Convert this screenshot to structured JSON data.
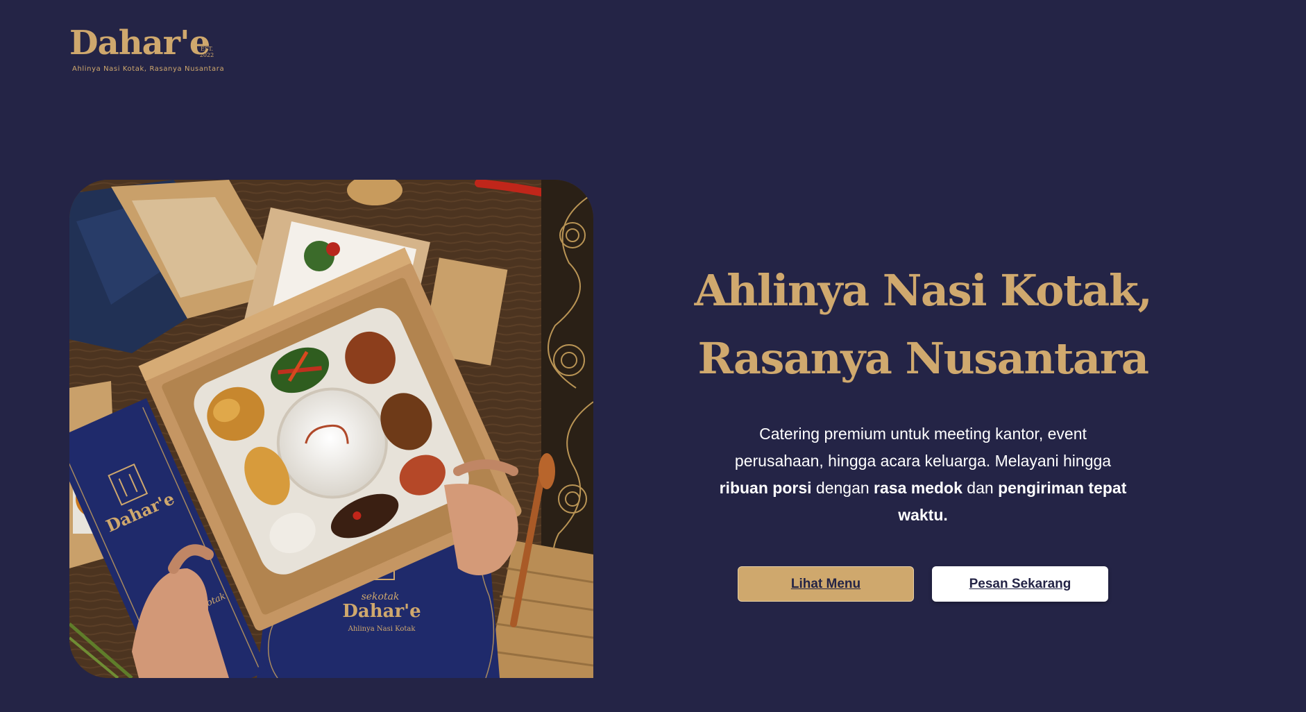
{
  "brand": {
    "name": "Dahar'e",
    "est_label": "EST.",
    "est_year": "2022",
    "tagline": "Ahlinya Nasi Kotak, Rasanya Nusantara"
  },
  "hero": {
    "title_line1": "Ahlinya Nasi Kotak,",
    "title_line2": "Rasanya Nusantara",
    "desc_part1": "Catering premium untuk meeting kantor, event perusahaan, hingga acara keluarga. Melayani hingga ",
    "desc_bold1": "ribuan porsi",
    "desc_part2": " dengan ",
    "desc_bold2": "rasa medok",
    "desc_part3": " dan ",
    "desc_bold3": "pengiriman tepat waktu.",
    "primary_button": "Lihat Menu",
    "secondary_button": "Pesan Sekarang"
  },
  "image_text": {
    "sleeve_brand": "Dahar'e",
    "sleeve_script": "Ahlinya Nasi Kotak",
    "box_brand_top": "sekotak",
    "box_brand": "Dahar'e",
    "box_tagline": "Ahlinya Nasi Kotak"
  },
  "colors": {
    "background": "#242446",
    "accent_gold": "#cfa86d",
    "text_white": "#ffffff",
    "navy_box": "#1f2a6b"
  }
}
